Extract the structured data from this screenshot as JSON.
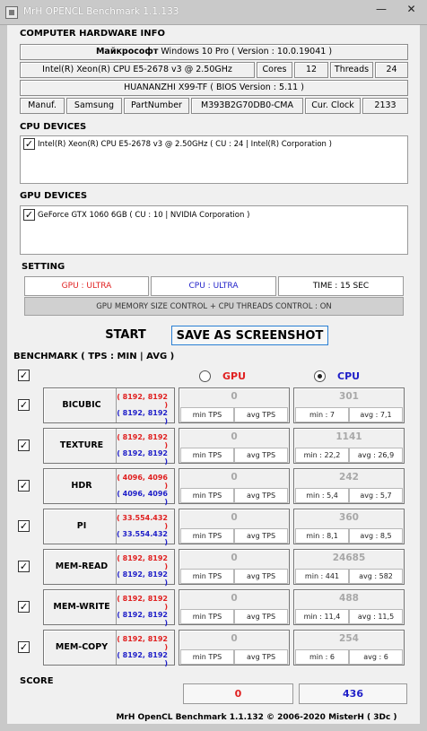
{
  "window": {
    "title": "MrH OPENCL Benchmark 1.1.133"
  },
  "hardware": {
    "heading": "COMPUTER HARDWARE INFO",
    "os_prefix": "Майкрософт",
    "os_rest": "Windows 10 Pro ( Version : 10.0.19041 )",
    "cpu": "Intel(R) Xeon(R) CPU E5-2678 v3 @ 2.50GHz",
    "cores_label": "Cores",
    "cores_value": "12",
    "threads_label": "Threads",
    "threads_value": "24",
    "board": "HUANANZHI X99-TF ( BIOS Version : 5.11 )",
    "manuf_label": "Manuf.",
    "manuf_value": "Samsung",
    "part_label": "PartNumber",
    "part_value": "M393B2G70DB0-CMA",
    "clock_label": "Cur. Clock",
    "clock_value": "2133"
  },
  "cpu_devices": {
    "heading": "CPU DEVICES",
    "items": [
      "Intel(R) Xeon(R) CPU E5-2678 v3 @ 2.50GHz ( CU : 24 | Intel(R) Corporation )"
    ]
  },
  "gpu_devices": {
    "heading": "GPU DEVICES",
    "items": [
      "GeForce GTX 1060 6GB ( CU : 10 | NVIDIA Corporation )"
    ]
  },
  "setting": {
    "heading": "SETTING",
    "gpu": "GPU : ULTRA",
    "cpu": "CPU : ULTRA",
    "time": "TIME : 15 SEC",
    "control": "GPU MEMORY SIZE CONTROL + CPU THREADS CONTROL : ON",
    "colors": {
      "gpu": "#e02020",
      "cpu": "#1e1ec8"
    }
  },
  "actions": {
    "start": "START",
    "save": "SAVE AS SCREENSHOT"
  },
  "benchmark": {
    "heading": "BENCHMARK ( TPS : MIN | AVG )",
    "gpu_label": "GPU",
    "cpu_label": "CPU",
    "selected": "CPU",
    "rows": [
      {
        "name": "BICUBIC",
        "gpu_size": "( 8192, 8192 )",
        "cpu_size": "( 8192, 8192 )",
        "gpu_value": "0",
        "gpu_min": "min TPS",
        "gpu_avg": "avg TPS",
        "cpu_value": "301",
        "cpu_min": "min : 7",
        "cpu_avg": "avg : 7,1"
      },
      {
        "name": "TEXTURE",
        "gpu_size": "( 8192, 8192 )",
        "cpu_size": "( 8192, 8192 )",
        "gpu_value": "0",
        "gpu_min": "min TPS",
        "gpu_avg": "avg TPS",
        "cpu_value": "1141",
        "cpu_min": "min : 22,2",
        "cpu_avg": "avg : 26,9"
      },
      {
        "name": "HDR",
        "gpu_size": "( 4096, 4096 )",
        "cpu_size": "( 4096, 4096 )",
        "gpu_value": "0",
        "gpu_min": "min TPS",
        "gpu_avg": "avg TPS",
        "cpu_value": "242",
        "cpu_min": "min : 5,4",
        "cpu_avg": "avg : 5,7"
      },
      {
        "name": "PI",
        "gpu_size": "( 33.554.432 )",
        "cpu_size": "( 33.554.432 )",
        "gpu_value": "0",
        "gpu_min": "min TPS",
        "gpu_avg": "avg TPS",
        "cpu_value": "360",
        "cpu_min": "min : 8,1",
        "cpu_avg": "avg : 8,5"
      },
      {
        "name": "MEM-READ",
        "gpu_size": "( 8192, 8192 )",
        "cpu_size": "( 8192, 8192 )",
        "gpu_value": "0",
        "gpu_min": "min TPS",
        "gpu_avg": "avg TPS",
        "cpu_value": "24685",
        "cpu_min": "min : 441",
        "cpu_avg": "avg : 582"
      },
      {
        "name": "MEM-WRITE",
        "gpu_size": "( 8192, 8192 )",
        "cpu_size": "( 8192, 8192 )",
        "gpu_value": "0",
        "gpu_min": "min TPS",
        "gpu_avg": "avg TPS",
        "cpu_value": "488",
        "cpu_min": "min : 11,4",
        "cpu_avg": "avg : 11,5"
      },
      {
        "name": "MEM-COPY",
        "gpu_size": "( 8192, 8192 )",
        "cpu_size": "( 8192, 8192 )",
        "gpu_value": "0",
        "gpu_min": "min TPS",
        "gpu_avg": "avg TPS",
        "cpu_value": "254",
        "cpu_min": "min : 6",
        "cpu_avg": "avg : 6"
      }
    ]
  },
  "score": {
    "heading": "SCORE",
    "gpu": "0",
    "cpu": "436"
  },
  "footer": "MrH OpenCL Benchmark 1.1.132  ©  2006-2020 MisterH ( 3Dc )"
}
